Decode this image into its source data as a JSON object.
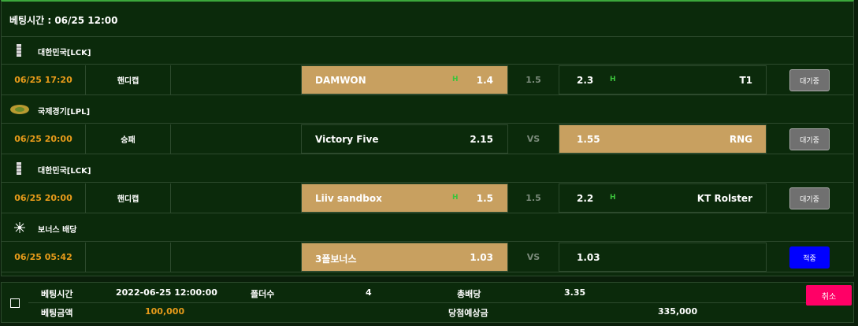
{
  "header": {
    "title": "베팅시간 : 06/25 12:00"
  },
  "leagues": [
    {
      "name": "대한민국[LCK]",
      "icon": "lol-icon"
    },
    {
      "name": "국제경기[LPL]",
      "icon": "globe-icon"
    },
    {
      "name": "대한민국[LCK]",
      "icon": "lol-icon"
    },
    {
      "name": "보너스 배당",
      "icon": "sparkle-icon"
    }
  ],
  "matches": [
    {
      "time": "06/25 17:20",
      "type": "핸디캡",
      "home": "DAMWON",
      "home_odds": "1.4",
      "home_ind": "H",
      "mid": "1.5",
      "away_odds": "2.3",
      "away_ind": "H",
      "away": "T1",
      "status": "대기중",
      "home_selected": true,
      "away_selected": false
    },
    {
      "time": "06/25 20:00",
      "type": "승패",
      "home": "Victory Five",
      "home_odds": "2.15",
      "home_ind": "",
      "mid": "VS",
      "away_odds": "1.55",
      "away_ind": "",
      "away": "RNG",
      "status": "대기중",
      "home_selected": false,
      "away_selected": true
    },
    {
      "time": "06/25 20:00",
      "type": "핸디캡",
      "home": "Liiv sandbox",
      "home_odds": "1.5",
      "home_ind": "H",
      "mid": "1.5",
      "away_odds": "2.2",
      "away_ind": "H",
      "away": "KT Rolster",
      "status": "대기중",
      "home_selected": true,
      "away_selected": false
    },
    {
      "time": "06/25 05:42",
      "type": "",
      "home": "3폴보너스",
      "home_odds": "1.03",
      "home_ind": "",
      "mid": "VS",
      "away_odds": "1.03",
      "away_ind": "",
      "away": "",
      "status": "적중",
      "home_selected": true,
      "away_selected": false
    }
  ],
  "footer": {
    "bet_time_label": "베팅시간",
    "bet_time_value": "2022-06-25 12:00:00",
    "folder_label": "폴더수",
    "folder_value": "4",
    "total_odds_label": "총배당",
    "total_odds_value": "3.35",
    "bet_amount_label": "베팅금액",
    "bet_amount_value": "100,000",
    "expected_label": "당첨예상금",
    "expected_value": "335,000",
    "cancel_label": "취소"
  },
  "colors": {
    "accent": "#3ca83c",
    "selected": "#c8a060",
    "time": "#e79b1a",
    "wait": "#707070",
    "hit": "#0000ff",
    "cancel": "#ff0066"
  }
}
